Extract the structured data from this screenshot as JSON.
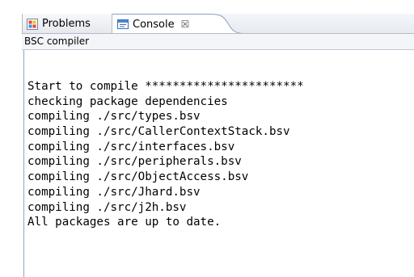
{
  "tabs": [
    {
      "label": "Problems",
      "icon": "problems-icon",
      "active": false
    },
    {
      "label": "Console",
      "icon": "console-icon",
      "active": true,
      "close_glyph": "☒"
    }
  ],
  "console": {
    "name": "BSC compiler",
    "lines": [
      "Start to compile ***********************",
      "checking package dependencies",
      "compiling ./src/types.bsv",
      "compiling ./src/CallerContextStack.bsv",
      "compiling ./src/interfaces.bsv",
      "compiling ./src/peripherals.bsv",
      "compiling ./src/ObjectAccess.bsv",
      "compiling ./src/Jhard.bsv",
      "compiling ./src/j2h.bsv",
      "All packages are up to date."
    ]
  },
  "colors": {
    "tab_border": "#b5bcc6",
    "console_left_rule": "#8ea2c7",
    "titlebar_bg": "#f3f5f8"
  }
}
